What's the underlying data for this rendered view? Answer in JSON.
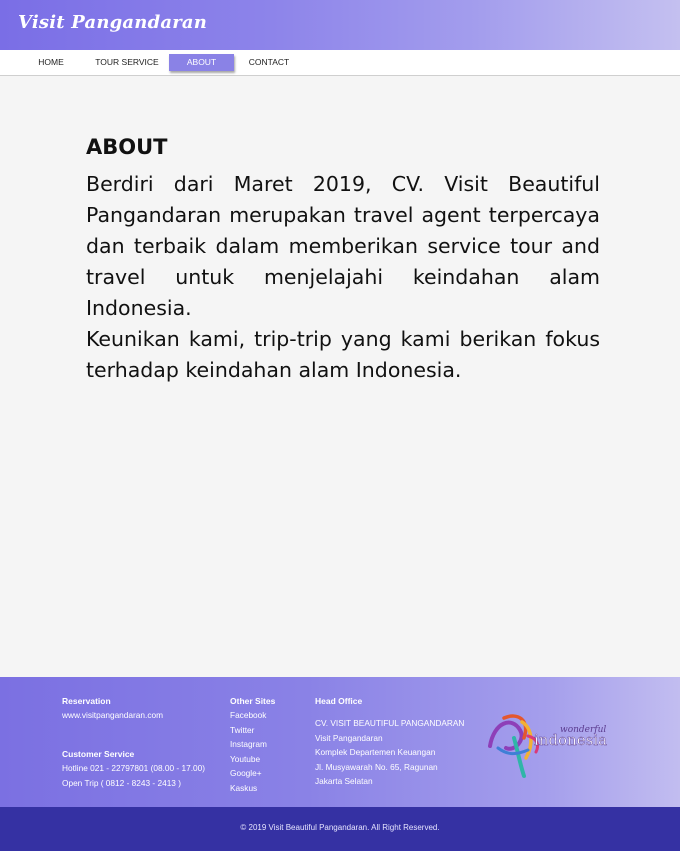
{
  "site": {
    "logo": "Visit Pangandaran"
  },
  "nav": {
    "items": [
      {
        "label": "HOME"
      },
      {
        "label": "TOUR SERVICE"
      },
      {
        "label": "ABOUT"
      },
      {
        "label": "CONTACT"
      }
    ],
    "active": "ABOUT"
  },
  "main": {
    "title": "ABOUT",
    "paragraphs": [
      "Berdiri dari Maret 2019, CV. Visit Beautiful Pangandaran merupakan travel agent terpercaya dan terbaik dalam memberikan service tour and travel untuk menjelajahi keindahan alam Indonesia.",
      "Keunikan kami, trip-trip yang kami berikan fokus terhadap keindahan alam Indonesia."
    ]
  },
  "footer": {
    "reservation": {
      "heading": "Reservation",
      "website": "www.visitpangandaran.com"
    },
    "customer_service": {
      "heading": "Customer Service",
      "hotline": "Hotline 021 - 22797801 (08.00 - 17.00)",
      "open_trip": "Open Trip ( 0812 - 8243 - 2413 )"
    },
    "other_sites": {
      "heading": "Other Sites",
      "links": [
        "Facebook",
        "Twitter",
        "Instagram",
        "Youtube",
        "Google+",
        "Kaskus"
      ]
    },
    "head_office": {
      "heading": "Head Office",
      "lines": [
        "CV. VISIT BEAUTIFUL PANGANDARAN",
        "Visit Pangandaran",
        "Komplek Departemen Keuangan",
        "Jl. Musyawarah No. 65, Ragunan",
        "Jakarta Selatan"
      ]
    },
    "brand_logo": {
      "top": "wonderful",
      "main": "indonesia"
    },
    "copyright": "© 2019 Visit Beautiful Pangandaran. All Right Reserved."
  },
  "colors": {
    "header_accent": "#7a6ee6",
    "nav_active": "#8a82e6",
    "footer_bottom": "#3531a3"
  }
}
